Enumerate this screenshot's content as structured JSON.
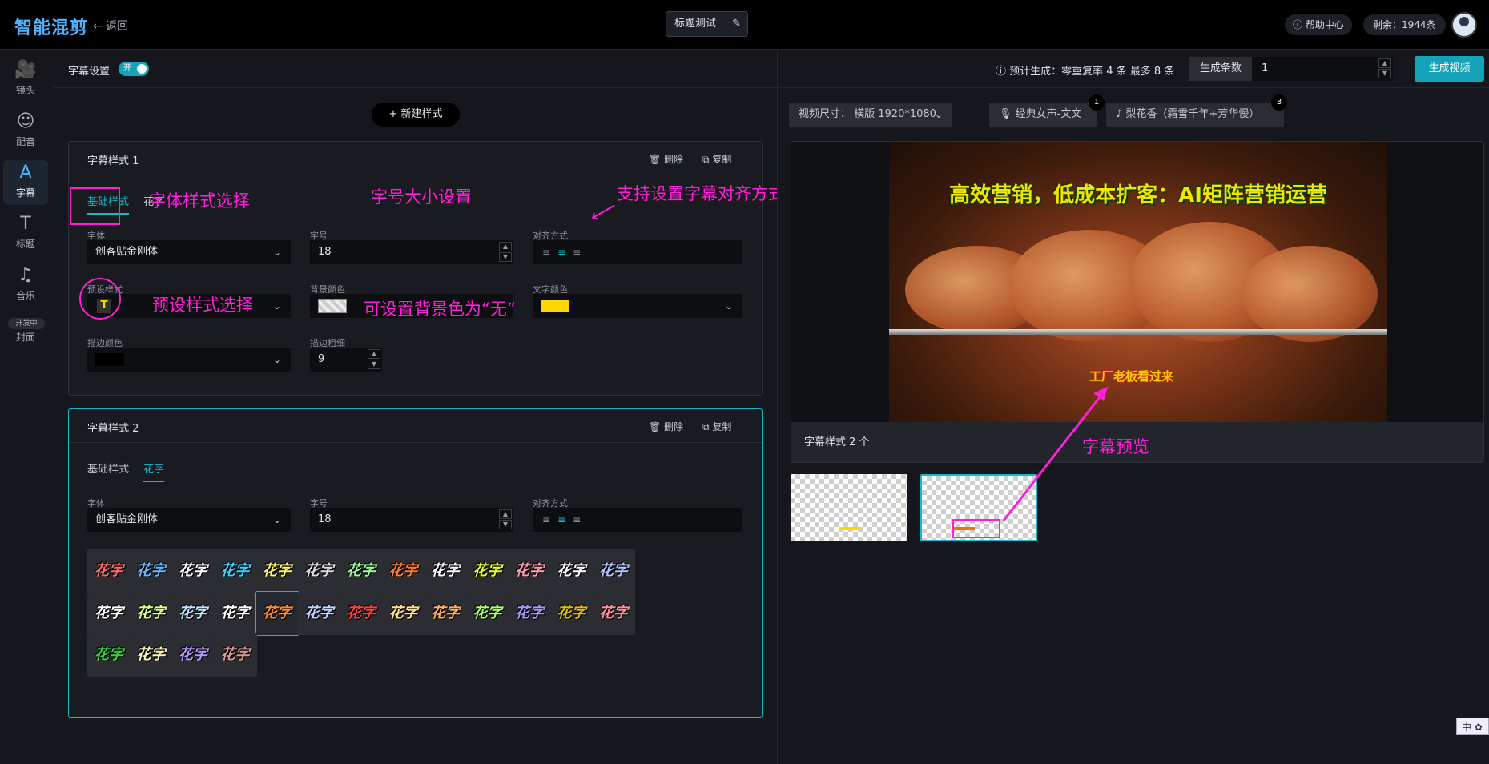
{
  "app": {
    "title": "智能混剪",
    "back": "← 返回",
    "project_title": "标题测试",
    "help": "ⓘ 帮助中心",
    "quota": "剩余：1944条"
  },
  "sidebar": {
    "items": [
      {
        "label": "镜头",
        "icon": "🎥"
      },
      {
        "label": "配音",
        "icon": "☺"
      },
      {
        "label": "字幕",
        "icon": "A"
      },
      {
        "label": "标题",
        "icon": "T"
      },
      {
        "label": "音乐",
        "icon": "♫"
      },
      {
        "label": "封面",
        "icon": ""
      }
    ],
    "dev_badge": "开发中"
  },
  "left": {
    "header_label": "字幕设置",
    "toggle_label": "开",
    "new_style": "+ 新建样式",
    "card1": {
      "title": "字幕样式 1",
      "delete": "🗑 删除",
      "copy": "⧉ 复制",
      "tab_basic": "基础样式",
      "tab_fancy": "花字",
      "font_label": "字体",
      "font_value": "创客贴金刚体",
      "size_label": "字号",
      "size_value": "18",
      "align_label": "对齐方式",
      "preset_label": "预设样式",
      "preset_value": "T",
      "bg_label": "背景颜色",
      "text_color_label": "文字颜色",
      "stroke_color_label": "描边颜色",
      "stroke_width_label": "描边粗细",
      "stroke_width_value": "9"
    },
    "card2": {
      "title": "字幕样式 2",
      "delete": "🗑 删除",
      "copy": "⧉ 复制",
      "tab_basic": "基础样式",
      "tab_fancy": "花字",
      "font_label": "字体",
      "font_value": "创客贴金刚体",
      "size_label": "字号",
      "size_value": "18",
      "align_label": "对齐方式",
      "tile_label": "花字",
      "tile_count": 30,
      "selected_tile": 17
    }
  },
  "right": {
    "estimate": "ⓘ 预计生成：零重复率 4 条 最多 8 条",
    "count_label": "生成条数",
    "count_value": "1",
    "generate": "生成视频",
    "video_size": "视频尺寸：  横版 1920*1080",
    "voice": "🎙 经典女声-文文",
    "voice_badge": "1",
    "music": "♪ 梨花香（霜雪千年+芳华慢）",
    "music_badge": "3",
    "video_title": "高效营销，低成本扩客：AI矩阵营销运营",
    "video_subtitle": "工厂老板看过来",
    "preview_footer": "字幕样式 2 个"
  },
  "annotations": {
    "font": "字体样式选择",
    "size": "字号大小设置",
    "align": "支持设置字幕对齐方式",
    "preset": "预设样式选择",
    "bg": "可设置背景色为“无”",
    "preview": "字幕预览"
  },
  "ime": "中 ✿",
  "colors": {
    "accent": "#14a3b8",
    "annotation": "#ff1fd8",
    "text_color": "#ffd700",
    "stroke_color": "#000000"
  }
}
